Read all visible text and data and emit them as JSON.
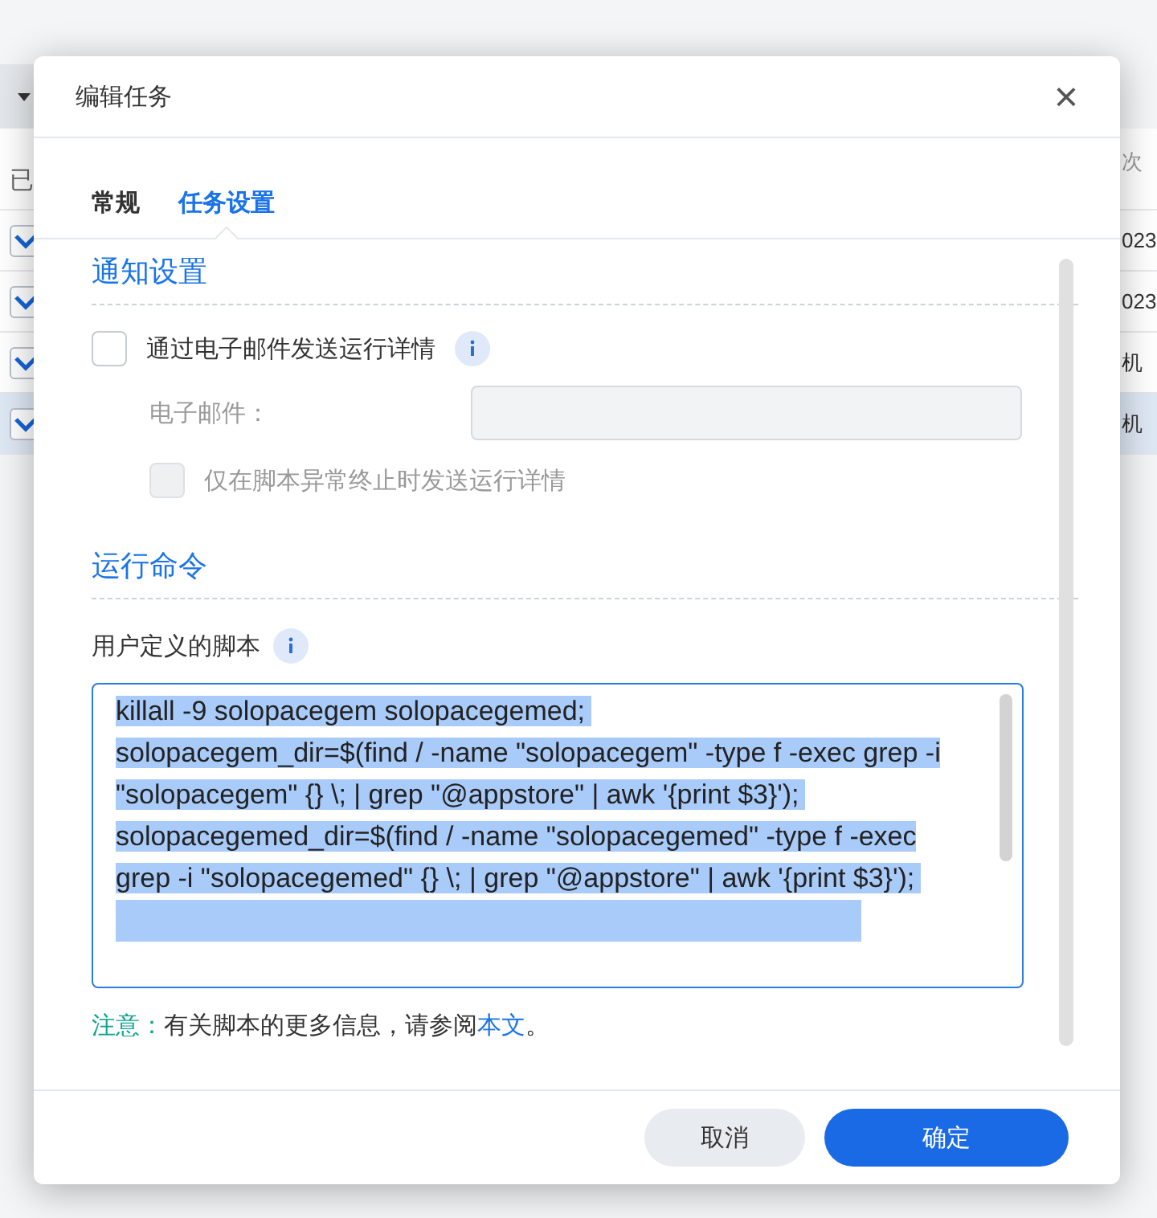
{
  "background_table": {
    "left_header": "已",
    "left_rows": [
      {
        "checked": true,
        "selected": false
      },
      {
        "checked": true,
        "selected": false
      },
      {
        "checked": true,
        "selected": false
      },
      {
        "checked": true,
        "selected": true
      }
    ],
    "right_header": "次",
    "right_rows": [
      {
        "text": "023",
        "selected": false
      },
      {
        "text": "023",
        "selected": false
      },
      {
        "text": "机",
        "selected": false
      },
      {
        "text": "机",
        "selected": true
      }
    ]
  },
  "dialog": {
    "title": "编辑任务",
    "close": "×",
    "tabs": [
      {
        "label": "常规",
        "selected": false
      },
      {
        "label": "任务设置",
        "selected": true
      }
    ],
    "notification": {
      "heading": "通知设置",
      "email_checkbox": {
        "label": "通过电子邮件发送运行详情",
        "checked": false
      },
      "email_label": "电子邮件：",
      "abnormal_checkbox": {
        "label": "仅在脚本异常终止时发送运行详情",
        "checked": false,
        "disabled": true
      }
    },
    "command": {
      "heading": "运行命令",
      "script_label": "用户定义的脚本",
      "script_lines": [
        "killall -9 solopacegem solopacegemed;",
        "solopacegem_dir=$(find / -name \"solopacegem\" -type f -exec grep -i \"solopacegem\" {} \\; | grep \"@appstore\" | awk '{print $3}');",
        "solopacegemed_dir=$(find / -name \"solopacegemed\" -type f -exec grep -i \"solopacegemed\" {} \\; | grep \"@appstore\" | awk '{print $3}');"
      ]
    },
    "note": {
      "prefix": "注意：",
      "text": "有关脚本的更多信息，请参阅",
      "link": "本文",
      "suffix": "。"
    },
    "buttons": [
      {
        "label": "取消",
        "kind": "secondary"
      },
      {
        "label": "确定",
        "kind": "primary"
      }
    ]
  }
}
